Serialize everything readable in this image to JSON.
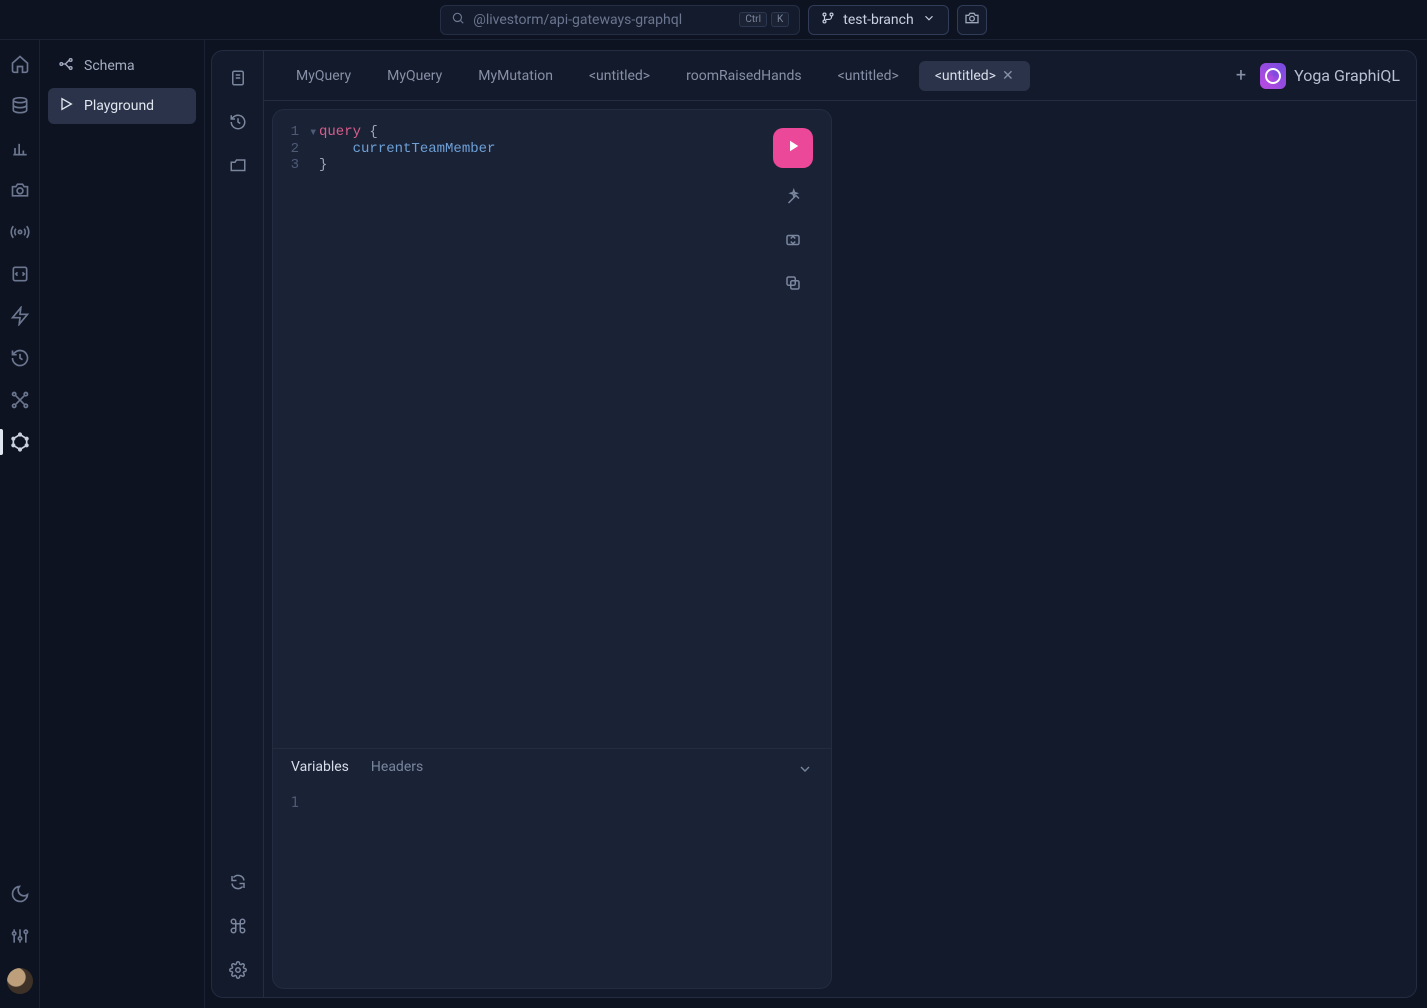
{
  "topbar": {
    "search_text": "@livestorm/api-gateways-graphql",
    "kbd_ctrl": "Ctrl",
    "kbd_k": "K",
    "branch_label": "test-branch"
  },
  "sidebar": {
    "items": [
      {
        "label": "Schema",
        "icon": "schema-icon",
        "active": false
      },
      {
        "label": "Playground",
        "icon": "play-icon",
        "active": true
      }
    ]
  },
  "playground": {
    "brand": "Yoga GraphiQL",
    "tabs": [
      {
        "label": "MyQuery",
        "active": false,
        "closable": false
      },
      {
        "label": "MyQuery",
        "active": false,
        "closable": false
      },
      {
        "label": "MyMutation",
        "active": false,
        "closable": false
      },
      {
        "label": "<untitled>",
        "active": false,
        "closable": false
      },
      {
        "label": "roomRaisedHands",
        "active": false,
        "closable": false
      },
      {
        "label": "<untitled>",
        "active": false,
        "closable": false
      },
      {
        "label": "<untitled>",
        "active": true,
        "closable": true
      }
    ],
    "code": {
      "lines": [
        {
          "n": "1",
          "fold": "▾",
          "tokens": [
            {
              "t": "query",
              "c": "kw"
            },
            {
              "t": " ",
              "c": ""
            },
            {
              "t": "{",
              "c": "brace"
            }
          ]
        },
        {
          "n": "2",
          "fold": "",
          "tokens": [
            {
              "t": "    ",
              "c": ""
            },
            {
              "t": "currentTeamMember",
              "c": "field"
            }
          ]
        },
        {
          "n": "3",
          "fold": "",
          "tokens": [
            {
              "t": "}",
              "c": "brace"
            }
          ]
        }
      ]
    },
    "vars_panel": {
      "tabs": [
        {
          "label": "Variables",
          "active": true
        },
        {
          "label": "Headers",
          "active": false
        }
      ],
      "line_number": "1"
    }
  }
}
